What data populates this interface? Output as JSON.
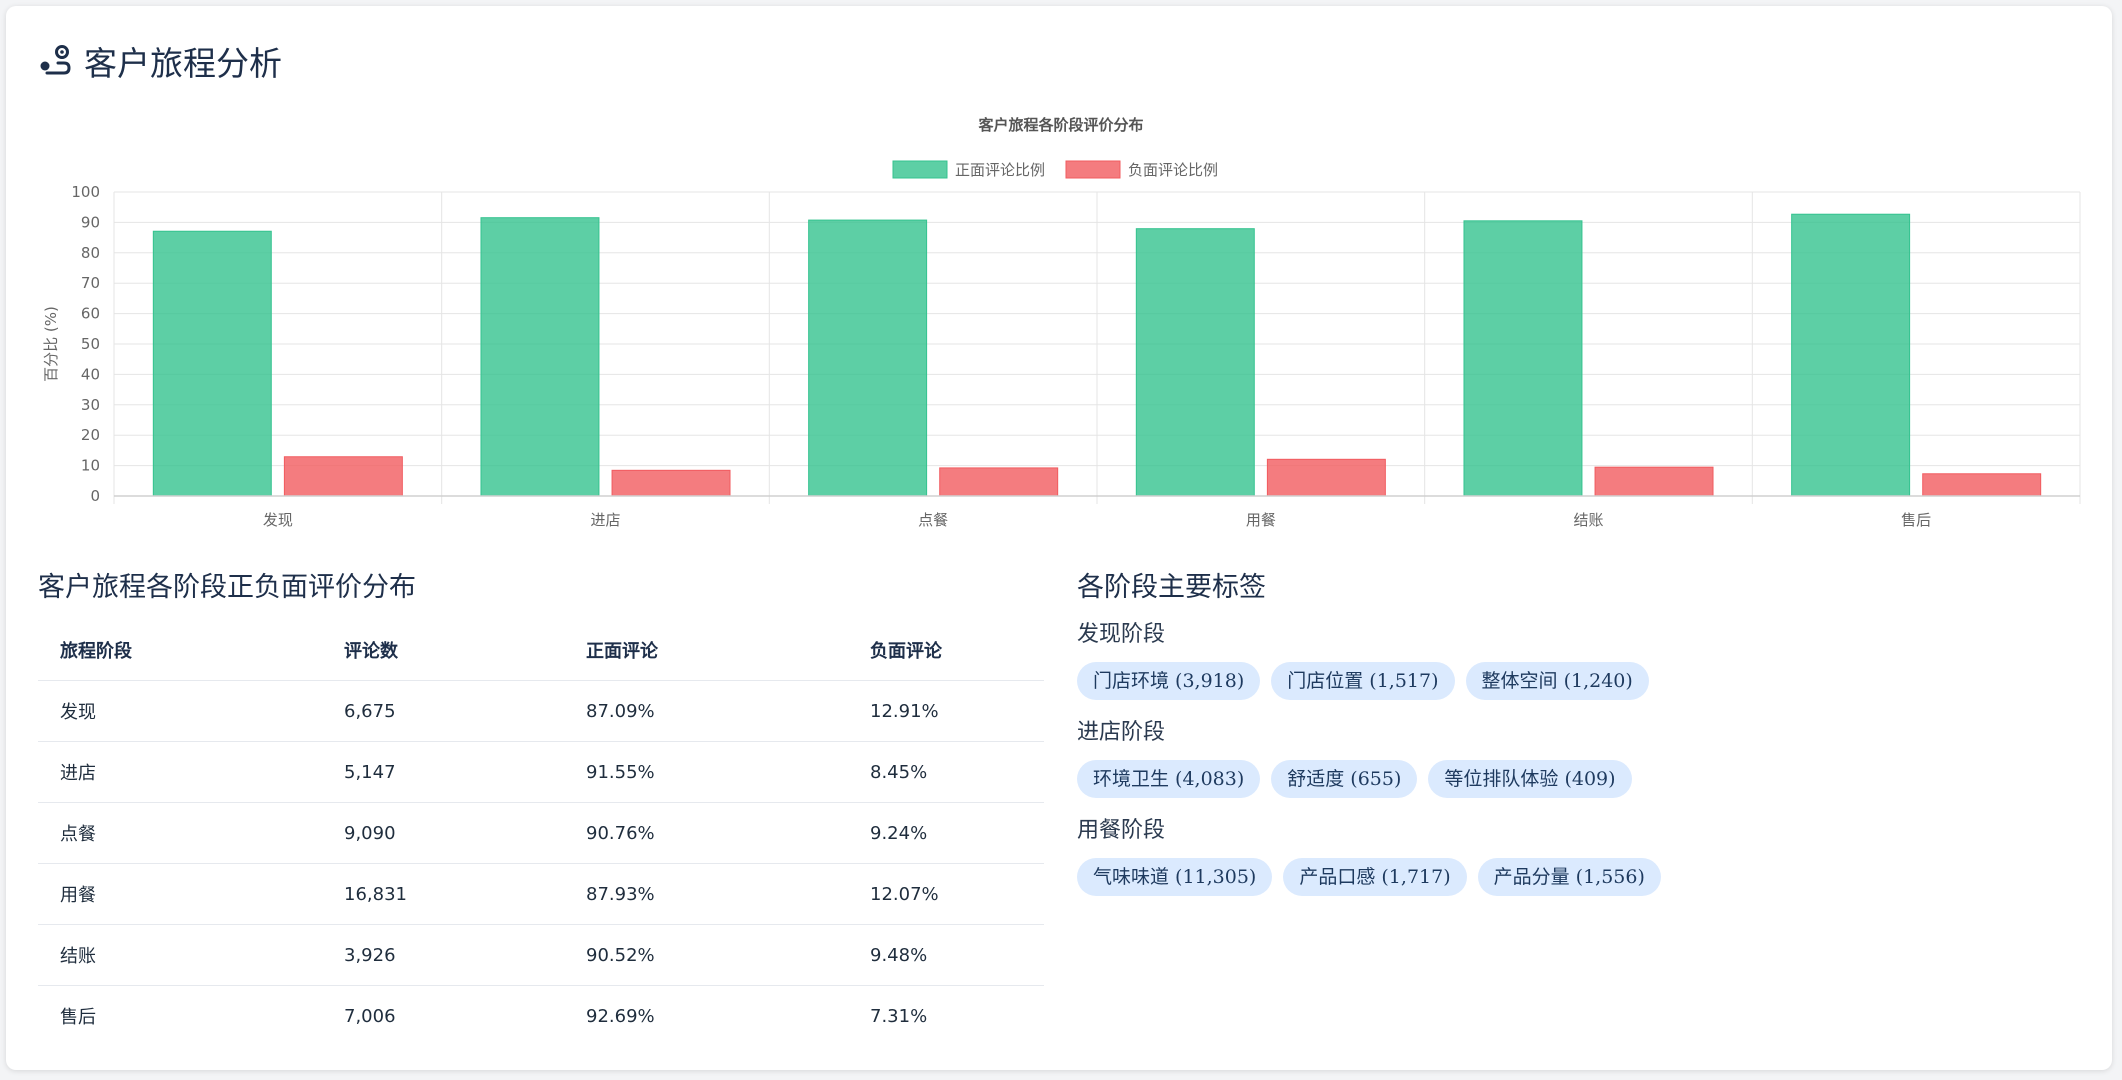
{
  "page": {
    "title": "客户旅程分析"
  },
  "chart_data": {
    "type": "bar",
    "title": "客户旅程各阶段评价分布",
    "categories": [
      "发现",
      "进店",
      "点餐",
      "用餐",
      "结账",
      "售后"
    ],
    "series": [
      {
        "name": "正面评论比例",
        "values": [
          87.09,
          91.55,
          90.76,
          87.93,
          90.52,
          92.69
        ],
        "color": "#34c38f"
      },
      {
        "name": "负面评论比例",
        "values": [
          12.91,
          8.45,
          9.24,
          12.07,
          9.48,
          7.31
        ],
        "color": "#f15b5f"
      }
    ],
    "ylabel": "百分比 (%)",
    "xlabel": "",
    "ylim": [
      0,
      100
    ],
    "yticks": [
      0,
      10,
      20,
      30,
      40,
      50,
      60,
      70,
      80,
      90,
      100
    ],
    "legend": "top-center",
    "grid": true
  },
  "table": {
    "title": "客户旅程各阶段正负面评价分布",
    "headers": [
      "旅程阶段",
      "评论数",
      "正面评论",
      "负面评论"
    ],
    "rows": [
      [
        "发现",
        "6,675",
        "87.09%",
        "12.91%"
      ],
      [
        "进店",
        "5,147",
        "91.55%",
        "8.45%"
      ],
      [
        "点餐",
        "9,090",
        "90.76%",
        "9.24%"
      ],
      [
        "用餐",
        "16,831",
        "87.93%",
        "12.07%"
      ],
      [
        "结账",
        "3,926",
        "90.52%",
        "9.48%"
      ],
      [
        "售后",
        "7,006",
        "92.69%",
        "7.31%"
      ]
    ]
  },
  "tags": {
    "title": "各阶段主要标签",
    "groups": [
      {
        "title": "发现阶段",
        "items": [
          "门店环境 (3,918)",
          "门店位置 (1,517)",
          "整体空间 (1,240)"
        ]
      },
      {
        "title": "进店阶段",
        "items": [
          "环境卫生 (4,083)",
          "舒适度 (655)",
          "等位排队体验 (409)"
        ]
      },
      {
        "title": "用餐阶段",
        "items": [
          "气味味道 (11,305)",
          "产品口感 (1,717)",
          "产品分量 (1,556)"
        ]
      }
    ]
  }
}
